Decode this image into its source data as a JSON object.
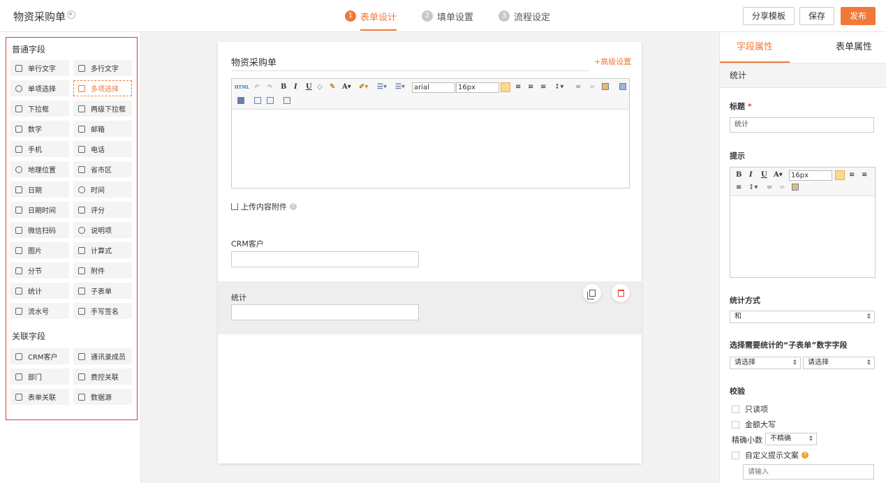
{
  "header": {
    "title": "物资采购单",
    "steps": [
      {
        "num": "1",
        "label": "表单设计"
      },
      {
        "num": "2",
        "label": "填单设置"
      },
      {
        "num": "3",
        "label": "流程设定"
      }
    ],
    "share_label": "分享模板",
    "save_label": "保存",
    "publish_label": "发布"
  },
  "palette": {
    "basic_title": "普通字段",
    "basic_fields": [
      {
        "label": "单行文字",
        "icon": "text-aa-icon"
      },
      {
        "label": "多行文字",
        "icon": "multiline-text-icon"
      },
      {
        "label": "单项选择",
        "icon": "radio-icon"
      },
      {
        "label": "多项选择",
        "icon": "checkbox-icon"
      },
      {
        "label": "下拉框",
        "icon": "dropdown-icon"
      },
      {
        "label": "两级下拉框",
        "icon": "cascade-dropdown-icon"
      },
      {
        "label": "数字",
        "icon": "number-icon"
      },
      {
        "label": "邮箱",
        "icon": "mail-icon"
      },
      {
        "label": "手机",
        "icon": "mobile-icon"
      },
      {
        "label": "电话",
        "icon": "phone-icon"
      },
      {
        "label": "地理位置",
        "icon": "location-icon"
      },
      {
        "label": "省市区",
        "icon": "region-icon"
      },
      {
        "label": "日期",
        "icon": "date-icon"
      },
      {
        "label": "时间",
        "icon": "clock-icon"
      },
      {
        "label": "日期时间",
        "icon": "datetime-icon"
      },
      {
        "label": "评分",
        "icon": "star-icon"
      },
      {
        "label": "微信扫码",
        "icon": "qrcode-icon"
      },
      {
        "label": "说明项",
        "icon": "info-icon"
      },
      {
        "label": "图片",
        "icon": "image-icon"
      },
      {
        "label": "计算式",
        "icon": "formula-icon"
      },
      {
        "label": "分节",
        "icon": "section-icon"
      },
      {
        "label": "附件",
        "icon": "attachment-icon"
      },
      {
        "label": "统计",
        "icon": "stats-icon"
      },
      {
        "label": "子表单",
        "icon": "subform-icon"
      },
      {
        "label": "流水号",
        "icon": "serial-icon"
      },
      {
        "label": "手写签名",
        "icon": "signature-icon"
      }
    ],
    "related_title": "关联字段",
    "related_fields": [
      {
        "label": "CRM客户",
        "icon": "crm-customer-icon"
      },
      {
        "label": "通讯录成员",
        "icon": "contact-icon"
      },
      {
        "label": "部门",
        "icon": "department-icon"
      },
      {
        "label": "费控关联",
        "icon": "expense-icon"
      },
      {
        "label": "表单关联",
        "icon": "form-link-icon"
      },
      {
        "label": "数据源",
        "icon": "datasource-icon"
      }
    ]
  },
  "canvas": {
    "form_title": "物资采购单",
    "advanced_link": "+高级设置",
    "editor": {
      "font": "arial",
      "size": "16px",
      "html_tag": "HTML"
    },
    "upload_label": "上传内容附件",
    "fields": [
      {
        "label": "CRM客户"
      },
      {
        "label": "统计"
      }
    ]
  },
  "props": {
    "tab_field": "字段属性",
    "tab_form": "表单属性",
    "section": "统计",
    "title_label": "标题",
    "title_required_mark": "*",
    "title_value": "统计",
    "hint_label": "提示",
    "hint_editor_size": "16px",
    "method_label": "统计方式",
    "method_value": "和",
    "subform_field_label": "选择需要统计的“子表单”数字字段",
    "select_placeholder_1": "请选择",
    "select_placeholder_2": "请选择",
    "validation_label": "校验",
    "readonly_label": "只读项",
    "uppercase_label": "金额大写",
    "precision_label": "精确小数",
    "precision_value": "不精确",
    "custom_hint_label": "自定义提示文案",
    "custom_hint_placeholder": "请输入"
  }
}
